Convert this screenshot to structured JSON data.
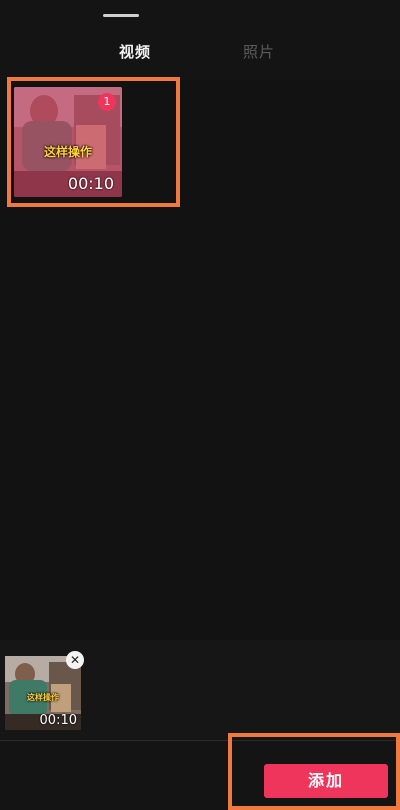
{
  "tabs": [
    {
      "label": "视频",
      "active": true
    },
    {
      "label": "照片",
      "active": false
    }
  ],
  "media_grid": {
    "selected_item": {
      "selection_number": "1",
      "caption": "这样操作",
      "duration": "00:10",
      "selected": true
    }
  },
  "selection_tray": {
    "item": {
      "caption": "这样操作",
      "duration": "00:10",
      "remove_icon": "close-icon",
      "remove_glyph": "✕"
    }
  },
  "actions": {
    "add_label": "添加"
  },
  "colors": {
    "accent": "#f0355d",
    "highlight": "#ee7a40",
    "background": "#141414",
    "active_tab": "#f2f2f2",
    "inactive_tab": "#5c5c5c"
  }
}
